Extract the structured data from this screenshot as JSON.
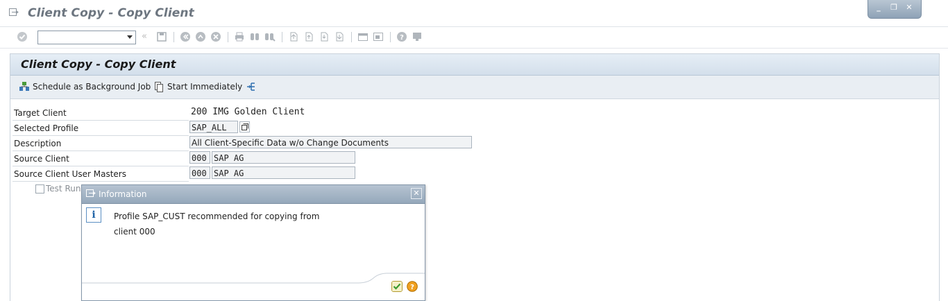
{
  "window": {
    "title": "Client Copy - Copy Client",
    "controls": {
      "minimize": "_",
      "restore": "❐",
      "close": "✕"
    }
  },
  "toolbar": {
    "command_field_value": "",
    "icons": [
      "enter-icon",
      "save-icon",
      "back-icon",
      "exit-icon",
      "cancel-icon",
      "print-icon",
      "find-icon",
      "find-next-icon",
      "first-page-icon",
      "previous-page-icon",
      "next-page-icon",
      "last-page-icon",
      "create-session-icon",
      "shortcut-icon",
      "help-icon",
      "layout-icon"
    ]
  },
  "panel": {
    "title": "Client Copy - Copy Client",
    "actions": {
      "schedule": "Schedule as Background Job",
      "start": "Start Immediately"
    }
  },
  "form": {
    "target_client": {
      "label": "Target Client",
      "value": "200 IMG Golden Client"
    },
    "selected_profile": {
      "label": "Selected Profile",
      "value": "SAP_ALL"
    },
    "description": {
      "label": "Description",
      "value": "All Client-Specific Data w/o Change Documents"
    },
    "source_client": {
      "label": "Source Client",
      "code": "000",
      "name": "SAP AG"
    },
    "source_client_user_masters": {
      "label": "Source Client User Masters",
      "code": "000",
      "name": "SAP AG"
    },
    "test_run": {
      "label": "Test Run",
      "checked": false
    }
  },
  "dialog": {
    "title": "Information",
    "message_line1": "Profile SAP_CUST recommended for copying from",
    "message_line2": "client 000",
    "close": "✕"
  },
  "colors": {
    "panel_header": "#d3dfeb",
    "dialog_header": "#95a8bb",
    "confirm_green": "#3a9a2f",
    "help_orange": "#f0a020"
  }
}
